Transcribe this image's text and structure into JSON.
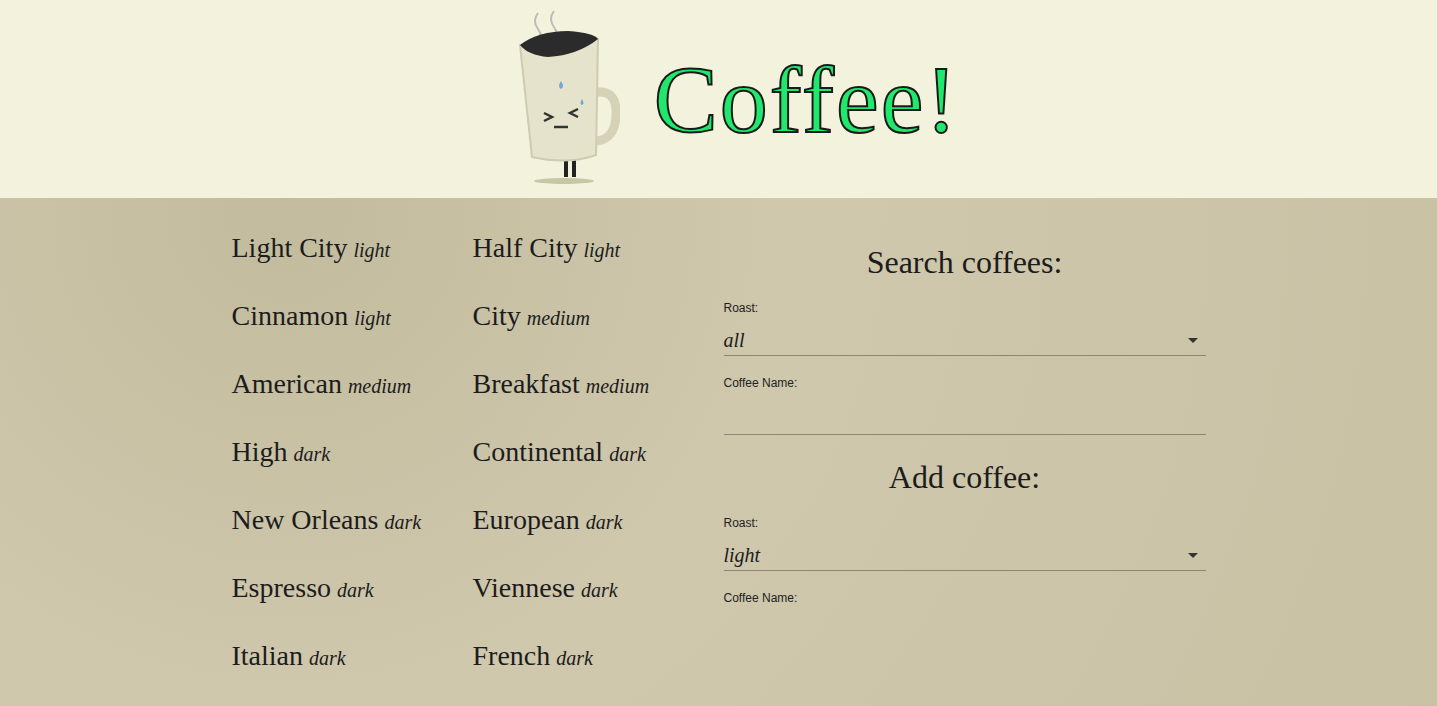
{
  "header": {
    "title": "Coffee!"
  },
  "coffees": [
    {
      "name": "Light City",
      "roast": "light"
    },
    {
      "name": "Half City",
      "roast": "light"
    },
    {
      "name": "Cinnamon",
      "roast": "light"
    },
    {
      "name": "City",
      "roast": "medium"
    },
    {
      "name": "American",
      "roast": "medium"
    },
    {
      "name": "Breakfast",
      "roast": "medium"
    },
    {
      "name": "High",
      "roast": "dark"
    },
    {
      "name": "Continental",
      "roast": "dark"
    },
    {
      "name": "New Orleans",
      "roast": "dark"
    },
    {
      "name": "European",
      "roast": "dark"
    },
    {
      "name": "Espresso",
      "roast": "dark"
    },
    {
      "name": "Viennese",
      "roast": "dark"
    },
    {
      "name": "Italian",
      "roast": "dark"
    },
    {
      "name": "French",
      "roast": "dark"
    }
  ],
  "search": {
    "heading": "Search coffees:",
    "roast_label": "Roast:",
    "roast_value": "all",
    "name_label": "Coffee Name:",
    "name_value": ""
  },
  "add": {
    "heading": "Add coffee:",
    "roast_label": "Roast:",
    "roast_value": "light",
    "name_label": "Coffee Name:"
  }
}
